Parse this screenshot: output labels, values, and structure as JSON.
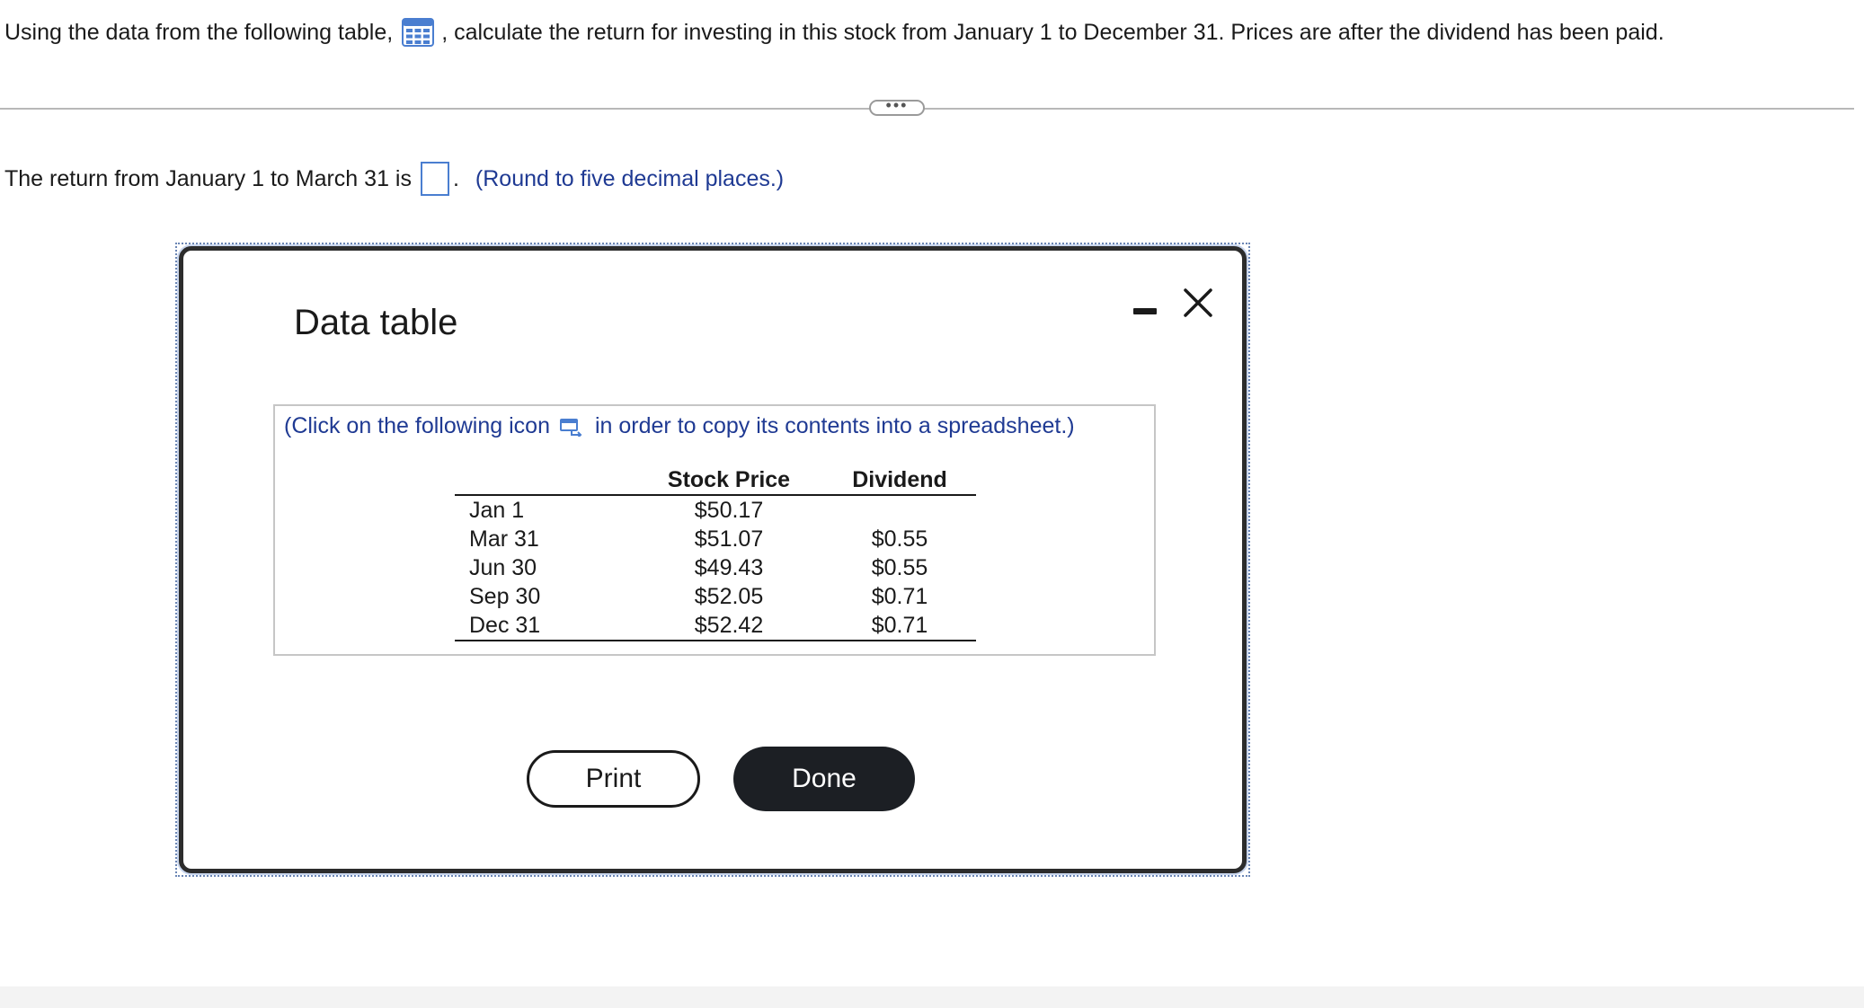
{
  "question": {
    "prefix": "Using the data from the following table,",
    "table_icon": "table-grid-icon",
    "suffix": ", calculate the return for investing in this stock from January 1 to December 31. Prices are after the dividend has been paid."
  },
  "expand_button": {
    "label": "•••"
  },
  "answer": {
    "prefix": "The return from January 1 to March 31 is",
    "value": "",
    "suffix": ".",
    "hint": "(Round to five decimal places.)"
  },
  "modal": {
    "title": "Data table",
    "minimize_icon": "minimize-icon",
    "close_icon": "close-icon",
    "note_prefix": "(Click on the following icon",
    "copy_icon": "copy-icon",
    "note_suffix": "in order to copy its contents into a spreadsheet.)",
    "table": {
      "headers": [
        "",
        "Stock Price",
        "Dividend"
      ],
      "rows": [
        {
          "date": "Jan 1",
          "price": "$50.17",
          "dividend": ""
        },
        {
          "date": "Mar 31",
          "price": "$51.07",
          "dividend": "$0.55"
        },
        {
          "date": "Jun 30",
          "price": "$49.43",
          "dividend": "$0.55"
        },
        {
          "date": "Sep 30",
          "price": "$52.05",
          "dividend": "$0.71"
        },
        {
          "date": "Dec 31",
          "price": "$52.42",
          "dividend": "$0.71"
        }
      ]
    },
    "print_label": "Print",
    "done_label": "Done"
  },
  "colors": {
    "accent_blue": "#1f3a93",
    "input_border": "#4a7ed0",
    "done_bg": "#1c1f24"
  }
}
